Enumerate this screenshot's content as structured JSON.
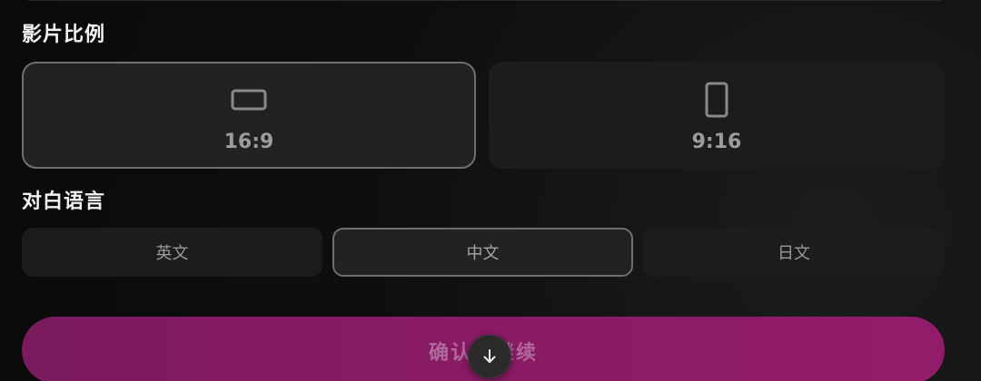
{
  "aspect_ratio": {
    "title": "影片比例",
    "options": [
      {
        "label": "16:9",
        "icon": "landscape-rectangle-icon",
        "selected": true
      },
      {
        "label": "9:16",
        "icon": "portrait-phone-icon",
        "selected": false
      }
    ]
  },
  "dialogue_language": {
    "title": "对白语言",
    "options": [
      {
        "label": "英文",
        "selected": false
      },
      {
        "label": "中文",
        "selected": true
      },
      {
        "label": "日文",
        "selected": false
      }
    ]
  },
  "confirm_button": {
    "label": "确认并继续"
  },
  "scroll_down": {
    "icon": "arrow-down-icon"
  },
  "colors": {
    "accent": "#8a1a66",
    "selected_border": "#6f6f6f",
    "card_bg": "#1c1c1c"
  }
}
